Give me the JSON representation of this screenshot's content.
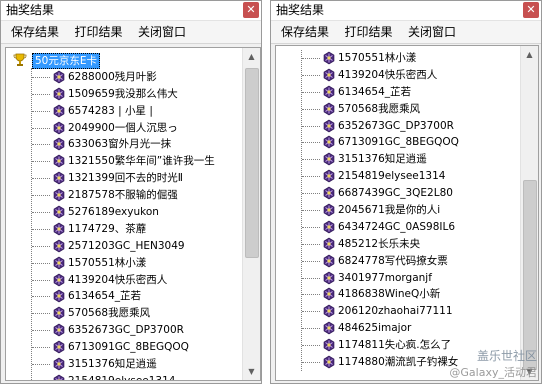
{
  "left_window": {
    "title": "抽奖结果",
    "close_label": "✕",
    "menu": [
      "保存结果",
      "打印结果",
      "关闭窗口"
    ],
    "root_label": "50元京东E卡",
    "items": [
      "6288000残月叶影",
      "1509659我没那么伟大",
      "6574283 | 小星 |",
      "2049900一個人沉思っ",
      "633063窗外月光一抹",
      "1321550繁华年间”谁许我一生",
      "1321399回不去的时光Ⅱ",
      "2187578不服输的倔强",
      "5276189exyukon",
      "1174729、茶蘼",
      "2571203GC_HEN3049",
      "1570551林小漾",
      "4139204快乐密西人",
      "6134654_芷若",
      "570568我愿乘风",
      "6352673GC_DP3700R",
      "6713091GC_8BEGQOQ",
      "3151376知足逍遥",
      "2154819elysee1314"
    ]
  },
  "right_window": {
    "title": "抽奖结果",
    "close_label": "✕",
    "menu": [
      "保存结果",
      "打印结果",
      "关闭窗口"
    ],
    "items": [
      "1570551林小漾",
      "4139204快乐密西人",
      "6134654_芷若",
      "570568我愿乘风",
      "6352673GC_DP3700R",
      "6713091GC_8BEGQOQ",
      "3151376知足逍遥",
      "2154819elysee1314",
      "6687439GC_3QE2L80",
      "2045671我是你的人i",
      "6434724GC_0AS98IL6",
      "485212长乐未央",
      "6824778写代码撩女票",
      "3401977morganjf",
      "4186838WineQ小新",
      "206120zhaohai77111",
      "484625imajor",
      "1174811失心疯.怎么了",
      "1174880潮流凯子钓裸女"
    ]
  },
  "watermark": {
    "line1": "盖乐世社区",
    "line2": "@Galaxy_活动君"
  }
}
